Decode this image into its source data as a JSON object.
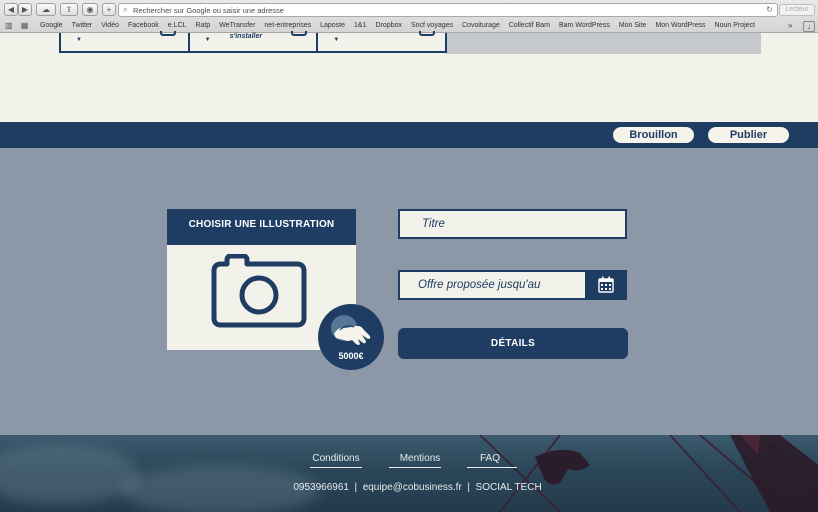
{
  "browser": {
    "url_placeholder": "Rechercher sur Google ou saisir une adresse",
    "reader_label": "Lecteur",
    "bookmarks": [
      "Google",
      "Twitter",
      "Vidéo",
      "Facebook",
      "e.LCL",
      "Ratp",
      "WeTransfer",
      "net-entreprises",
      "Laposte",
      "1&1",
      "Dropbox",
      "Sncf voyages",
      "Covoiturage",
      "Collectif Bam",
      "Bam WordPress",
      "Mon Site",
      "Mon WordPress",
      "Noun Project"
    ],
    "more_label": "»"
  },
  "top_cards": {
    "install_label": "s'installer"
  },
  "navbar": {
    "draft_label": "Brouillon",
    "publish_label": "Publier"
  },
  "illustration": {
    "header": "CHOISIR UNE ILLUSTRATION",
    "badge_amount": "5000€"
  },
  "form": {
    "title_placeholder": "Titre",
    "offer_placeholder": "Offre proposée jusqu'au",
    "details_label": "DÉTAILS"
  },
  "footer": {
    "links": [
      "Conditions",
      "Mentions",
      "FAQ"
    ],
    "phone": "0953966961",
    "email": "equipe@cobusiness.fr",
    "brand": "SOCIAL TECH",
    "separator": "|"
  },
  "colors": {
    "navy": "#1f3d63",
    "cream": "#f2f1ea",
    "body_bg": "#8c98a8"
  }
}
